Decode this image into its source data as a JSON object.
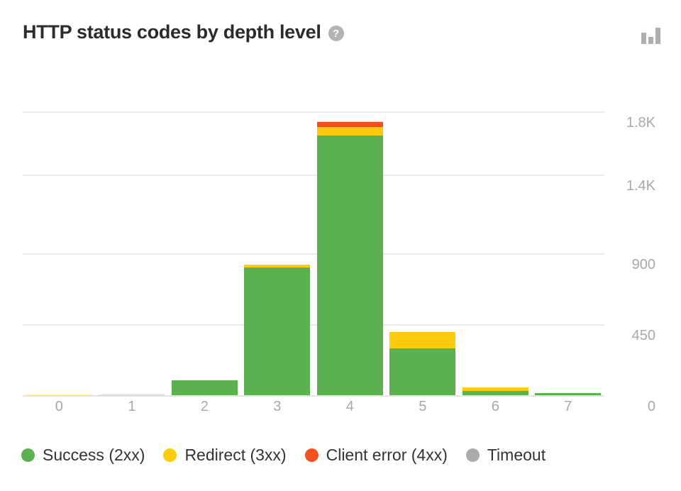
{
  "header": {
    "title": "HTTP status codes by depth level",
    "help_icon": "help-circle-icon",
    "help_glyph": "?",
    "chart_type_icon": "bar-chart-icon"
  },
  "colors": {
    "success": "#5BB04F",
    "redirect": "#FCCB0B",
    "client_error": "#F4501E",
    "timeout": "#ABABAB",
    "grid": "#EBEBEB",
    "axis_text": "#A8A8A8",
    "title_text": "#2B2B2B"
  },
  "legend": {
    "position": "bottom-left",
    "items": [
      {
        "label": "Success (2xx)",
        "color": "#5BB04F",
        "key": "success"
      },
      {
        "label": "Redirect (3xx)",
        "color": "#FCCB0B",
        "key": "redirect"
      },
      {
        "label": "Client error (4xx)",
        "color": "#F4501E",
        "key": "client_error"
      },
      {
        "label": "Timeout",
        "color": "#ABABAB",
        "key": "timeout"
      }
    ]
  },
  "yaxis": {
    "position": "right",
    "ticks": [
      {
        "label": "1.8K",
        "value": 1800
      },
      {
        "label": "1.4K",
        "value": 1400
      },
      {
        "label": "900",
        "value": 900
      },
      {
        "label": "450",
        "value": 450
      },
      {
        "label": "0",
        "value": 0
      }
    ]
  },
  "xaxis": {
    "ticks": [
      "0",
      "1",
      "2",
      "3",
      "4",
      "5",
      "6",
      "7"
    ]
  },
  "chart_data": {
    "type": "bar",
    "stacked": true,
    "title": "HTTP status codes by depth level",
    "xlabel": "",
    "ylabel": "",
    "categories": [
      "0",
      "1",
      "2",
      "3",
      "4",
      "5",
      "6",
      "7"
    ],
    "ylim": [
      0,
      1830
    ],
    "ytick_values": [
      0,
      450,
      900,
      1400,
      1800
    ],
    "ytick_labels": [
      "0",
      "450",
      "900",
      "1.4K",
      "1.8K"
    ],
    "grid": true,
    "legend_position": "bottom",
    "series": [
      {
        "name": "Success (2xx)",
        "color": "#5BB04F",
        "values": [
          0,
          0,
          93,
          810,
          1645,
          295,
          26,
          13
        ]
      },
      {
        "name": "Redirect (3xx)",
        "color": "#FCCB0B",
        "values": [
          4,
          0,
          0,
          18,
          53,
          106,
          22,
          0
        ]
      },
      {
        "name": "Client error (4xx)",
        "color": "#F4501E",
        "values": [
          0,
          0,
          0,
          0,
          31,
          0,
          0,
          0
        ]
      },
      {
        "name": "Timeout",
        "color": "#ABABAB",
        "values": [
          0,
          4,
          0,
          0,
          6,
          0,
          0,
          0
        ]
      }
    ]
  }
}
